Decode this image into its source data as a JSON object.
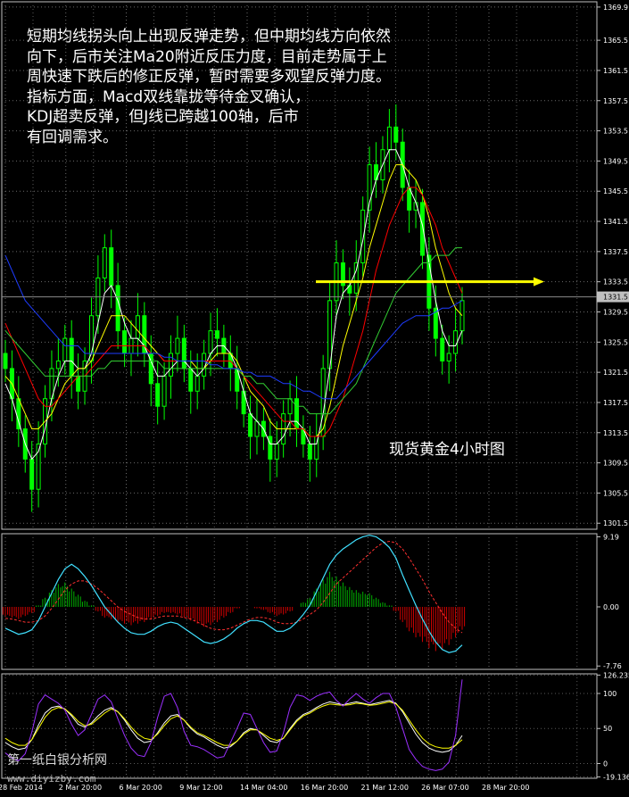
{
  "annotation_lines": [
    "短期均线拐头向上出现反弹走势，但中期均线方向依然",
    "向下，后市关注Ma20附近反压力度，目前走势属于上",
    "周快速下跌后的修正反弹，暂时需要多观望反弹力度。",
    "指标方面，Macd双线靠拢等待金叉确认，",
    "KDJ超卖反弹，但J线已跨越100轴，后市",
    "有回调需求。"
  ],
  "chart_label": "现货黄金4小时图",
  "watermark": "第一纸白银分析网",
  "watermark_url": "www.diyizby.com",
  "colors": {
    "background": "#000000",
    "candle": "#00ff00",
    "ma_fast": "#ffffff",
    "ma_yellow": "#ffff00",
    "ma_red": "#ff0000",
    "ma_green": "#32cd32",
    "ma_blue": "#1e3cff",
    "macd_up": "#00b000",
    "macd_down": "#d00000",
    "macd_signal": "#ff3030",
    "macd_line": "#40e0ff",
    "kdj_k": "#ffffff",
    "kdj_d": "#ffff00",
    "kdj_j": "#9b30ff",
    "arrow": "#ffff00",
    "price_marker": "#c0c0c0"
  },
  "chart_data": [
    {
      "type": "candlestick",
      "panel": "price",
      "y_ticks": [
        1369.9,
        1365.5,
        1361.5,
        1357.5,
        1353.5,
        1349.5,
        1345.5,
        1341.5,
        1337.5,
        1333.5,
        1329.5,
        1325.5,
        1321.5,
        1317.5,
        1313.5,
        1309.5,
        1305.5,
        1301.5
      ],
      "ylim": [
        1300.7,
        1370.6
      ],
      "current_price": 1331.5,
      "arrow_level": 1333.5,
      "x_ticks": [
        "28 Feb 2014",
        "2 Mar 20:00",
        "6 Mar 20:00",
        "9 Mar 12:00",
        "14 Mar 04:00",
        "16 Mar 20:00",
        "21 Mar 12:00",
        "26 Mar 07:00",
        "28 Mar 20:00"
      ],
      "series": [
        {
          "name": "",
          "type": "candles",
          "close": [
            1322.0,
            1318.0,
            1314.0,
            1310.0,
            1306.0,
            1312.0,
            1318.0,
            1322.0,
            1323.0,
            1326.0,
            1321.0,
            1319.0,
            1323.0,
            1329.0,
            1334.0,
            1338.0,
            1333.0,
            1327.0,
            1324.0,
            1326.0,
            1329.0,
            1324.0,
            1320.0,
            1317.0,
            1321.0,
            1324.0,
            1326.0,
            1322.0,
            1319.0,
            1321.0,
            1324.0,
            1327.0,
            1326.0,
            1324.0,
            1322.0,
            1319.0,
            1316.0,
            1313.0,
            1315.0,
            1313.0,
            1310.0,
            1312.0,
            1316.0,
            1318.0,
            1314.0,
            1312.0,
            1310.0,
            1313.0,
            1322.0,
            1331.0,
            1336.0,
            1333.0,
            1332.0,
            1336.0,
            1343.0,
            1349.0,
            1347.0,
            1351.0,
            1354.0,
            1352.0,
            1346.0,
            1343.0,
            1344.0,
            1337.0,
            1330.0,
            1326.0,
            1323.0,
            1324.0,
            1327.0,
            1331.0
          ]
        },
        {
          "name": "",
          "type": "ma",
          "values": [
            1320.0,
            1318.0,
            1315.0,
            1312.0,
            1310.0,
            1311.0,
            1314.0,
            1318.0,
            1321.0,
            1323.0,
            1323.0,
            1322.0,
            1322.0,
            1324.0,
            1328.0,
            1332.0,
            1333.0,
            1331.0,
            1328.0,
            1326.0,
            1326.0,
            1325.0,
            1323.0,
            1321.0,
            1321.0,
            1322.0,
            1323.0,
            1323.0,
            1322.0,
            1321.0,
            1322.0,
            1324.0,
            1325.0,
            1325.0,
            1324.0,
            1322.0,
            1319.0,
            1316.0,
            1315.0,
            1314.0,
            1312.0,
            1312.0,
            1313.0,
            1315.0,
            1315.0,
            1314.0,
            1312.0,
            1312.0,
            1316.0,
            1322.0,
            1329.0,
            1332.0,
            1333.0,
            1335.0,
            1339.0,
            1344.0,
            1347.0,
            1349.0,
            1351.0,
            1351.0,
            1349.0,
            1346.0,
            1344.0,
            1341.0,
            1336.0,
            1331.0,
            1327.0,
            1325.0,
            1325.0,
            1327.0
          ]
        },
        {
          "name": "",
          "type": "ma",
          "values": [
            1321.0,
            1320.0,
            1318.0,
            1316.0,
            1314.0,
            1314.0,
            1315.0,
            1316.0,
            1318.0,
            1320.0,
            1321.0,
            1322.0,
            1322.0,
            1323.0,
            1325.0,
            1327.0,
            1329.0,
            1329.0,
            1329.0,
            1328.0,
            1327.0,
            1326.0,
            1325.0,
            1324.0,
            1323.0,
            1323.0,
            1323.0,
            1323.0,
            1323.0,
            1322.0,
            1322.0,
            1323.0,
            1324.0,
            1324.0,
            1324.0,
            1323.0,
            1321.0,
            1319.0,
            1318.0,
            1317.0,
            1315.0,
            1314.0,
            1314.0,
            1314.0,
            1314.0,
            1314.0,
            1313.0,
            1313.0,
            1314.0,
            1317.0,
            1321.0,
            1325.0,
            1328.0,
            1331.0,
            1334.0,
            1338.0,
            1341.0,
            1344.0,
            1347.0,
            1349.0,
            1349.0,
            1348.0,
            1347.0,
            1345.0,
            1342.0,
            1338.0,
            1335.0,
            1332.0,
            1330.0,
            1329.0
          ]
        },
        {
          "name": "",
          "type": "ma",
          "values": [
            1328.0,
            1326.0,
            1324.0,
            1322.0,
            1320.0,
            1318.0,
            1317.0,
            1317.0,
            1318.0,
            1319.0,
            1320.0,
            1321.0,
            1321.0,
            1322.0,
            1323.0,
            1324.0,
            1325.0,
            1325.0,
            1325.0,
            1325.0,
            1325.0,
            1325.0,
            1324.0,
            1324.0,
            1323.0,
            1323.0,
            1323.0,
            1323.0,
            1323.0,
            1323.0,
            1323.0,
            1323.0,
            1323.0,
            1323.0,
            1323.0,
            1322.0,
            1321.0,
            1320.0,
            1319.0,
            1318.0,
            1317.0,
            1316.0,
            1315.0,
            1315.0,
            1314.0,
            1314.0,
            1313.0,
            1313.0,
            1313.0,
            1314.0,
            1316.0,
            1318.0,
            1321.0,
            1324.0,
            1327.0,
            1331.0,
            1335.0,
            1338.0,
            1341.0,
            1343.0,
            1345.0,
            1346.0,
            1346.0,
            1345.0,
            1343.0,
            1341.0,
            1338.0,
            1336.0,
            1334.0,
            1332.0
          ]
        },
        {
          "name": "",
          "type": "ma",
          "values": [
            1327.0,
            1326.0,
            1325.0,
            1324.0,
            1323.0,
            1322.0,
            1321.0,
            1321.0,
            1321.0,
            1321.0,
            1321.0,
            1321.0,
            1321.0,
            1321.0,
            1322.0,
            1322.0,
            1323.0,
            1323.0,
            1323.0,
            1323.0,
            1323.0,
            1323.0,
            1323.0,
            1323.0,
            1322.0,
            1322.0,
            1322.0,
            1322.0,
            1322.0,
            1322.0,
            1322.0,
            1322.0,
            1322.0,
            1322.0,
            1322.0,
            1322.0,
            1321.0,
            1321.0,
            1320.0,
            1320.0,
            1319.0,
            1318.0,
            1318.0,
            1318.0,
            1317.0,
            1317.0,
            1316.0,
            1316.0,
            1316.0,
            1316.0,
            1317.0,
            1318.0,
            1319.0,
            1320.0,
            1322.0,
            1324.0,
            1326.0,
            1328.0,
            1330.0,
            1332.0,
            1333.0,
            1334.0,
            1335.0,
            1336.0,
            1336.0,
            1337.0,
            1337.0,
            1337.0,
            1338.0,
            1338.0
          ]
        },
        {
          "name": "",
          "type": "ma",
          "values": [
            1337.0,
            1335.0,
            1333.0,
            1331.0,
            1330.0,
            1329.0,
            1328.0,
            1327.0,
            1326.0,
            1325.0,
            1325.0,
            1325.0,
            1324.0,
            1324.0,
            1324.0,
            1324.0,
            1324.0,
            1324.0,
            1324.0,
            1324.0,
            1324.0,
            1324.0,
            1324.0,
            1324.0,
            1323.5,
            1323.5,
            1323.0,
            1323.0,
            1323.0,
            1323.0,
            1323.0,
            1322.5,
            1322.5,
            1322.0,
            1322.0,
            1322.0,
            1321.5,
            1321.5,
            1321.0,
            1321.0,
            1321.0,
            1320.5,
            1320.0,
            1320.0,
            1319.5,
            1319.0,
            1319.0,
            1318.5,
            1318.0,
            1318.0,
            1318.0,
            1319.0,
            1320.0,
            1321.0,
            1322.0,
            1323.0,
            1324.0,
            1325.0,
            1326.0,
            1327.0,
            1328.0,
            1328.5,
            1329.0,
            1329.0,
            1329.0,
            1329.5,
            1330.0,
            1330.0,
            1330.5,
            1331.0
          ]
        }
      ]
    },
    {
      "type": "bar",
      "panel": "macd",
      "y_ticks": [
        9.19,
        0.0,
        -7.76
      ],
      "ylim": [
        -8.2,
        9.6
      ],
      "series": [
        {
          "name": "",
          "type": "histogram",
          "values": [
            -1.2,
            -1.4,
            -1.6,
            -1.2,
            -0.8,
            0.2,
            1.2,
            2.2,
            3.0,
            3.2,
            2.4,
            1.6,
            0.8,
            0.2,
            -0.6,
            -1.4,
            -1.6,
            -2.0,
            -2.2,
            -2.4,
            -2.2,
            -2.0,
            -1.6,
            -1.2,
            -0.8,
            -0.8,
            -1.0,
            -1.4,
            -1.8,
            -2.2,
            -2.6,
            -2.4,
            -2.0,
            -1.4,
            -0.8,
            -0.2,
            0.0,
            0.0,
            -0.2,
            -0.4,
            -0.8,
            -1.2,
            -1.0,
            -0.6,
            0.0,
            0.6,
            1.2,
            2.4,
            3.6,
            4.6,
            4.0,
            3.2,
            2.6,
            2.2,
            2.0,
            1.8,
            1.2,
            0.6,
            0.2,
            -0.6,
            -2.0,
            -3.2,
            -4.0,
            -4.6,
            -5.4,
            -5.8,
            -5.6,
            -5.0,
            -4.0,
            -3.0
          ]
        },
        {
          "name": "",
          "type": "line",
          "values": [
            -1.5,
            -1.6,
            -1.8,
            -2.0,
            -2.0,
            -1.8,
            -1.2,
            -0.2,
            1.0,
            2.2,
            3.0,
            3.4,
            3.4,
            3.0,
            2.4,
            1.6,
            0.8,
            0.0,
            -0.6,
            -1.0,
            -1.4,
            -1.6,
            -1.6,
            -1.4,
            -1.2,
            -1.2,
            -1.2,
            -1.4,
            -1.6,
            -2.0,
            -2.4,
            -2.8,
            -3.0,
            -3.0,
            -2.8,
            -2.4,
            -2.0,
            -1.6,
            -1.4,
            -1.4,
            -1.6,
            -2.0,
            -2.2,
            -2.2,
            -2.0,
            -1.6,
            -1.0,
            -0.4,
            0.6,
            1.8,
            3.0,
            3.8,
            4.6,
            5.4,
            6.2,
            7.0,
            7.8,
            8.4,
            8.6,
            8.4,
            7.6,
            6.4,
            5.0,
            3.6,
            2.0,
            0.6,
            -0.8,
            -2.0,
            -2.8,
            -3.4
          ]
        },
        {
          "name": "",
          "type": "line",
          "values": [
            -2.8,
            -3.2,
            -3.6,
            -3.4,
            -3.0,
            -1.8,
            0.0,
            1.8,
            3.6,
            5.0,
            5.6,
            5.0,
            4.0,
            2.8,
            1.4,
            0.0,
            -1.0,
            -2.0,
            -2.8,
            -3.4,
            -3.6,
            -3.6,
            -3.2,
            -2.6,
            -2.2,
            -2.0,
            -2.2,
            -2.8,
            -3.4,
            -4.0,
            -4.6,
            -4.8,
            -4.6,
            -4.2,
            -3.6,
            -2.8,
            -2.2,
            -1.8,
            -1.8,
            -2.0,
            -2.6,
            -3.2,
            -3.2,
            -2.8,
            -2.0,
            -1.0,
            0.2,
            2.0,
            3.8,
            5.6,
            6.8,
            7.6,
            8.2,
            8.8,
            9.2,
            9.4,
            9.2,
            8.6,
            7.8,
            6.4,
            4.2,
            2.2,
            0.2,
            -1.6,
            -3.2,
            -4.6,
            -5.6,
            -6.0,
            -5.8,
            -5.0
          ]
        }
      ]
    },
    {
      "type": "line",
      "panel": "kdj",
      "y_ticks": [
        126.235,
        100,
        50,
        0,
        -19.1369
      ],
      "ylim": [
        -21,
        128
      ],
      "series": [
        {
          "name": "",
          "values": [
            30,
            24,
            20,
            22,
            34,
            55,
            72,
            80,
            82,
            78,
            68,
            56,
            52,
            58,
            68,
            76,
            80,
            74,
            62,
            48,
            36,
            30,
            32,
            44,
            58,
            68,
            70,
            62,
            50,
            42,
            38,
            32,
            26,
            22,
            24,
            32,
            44,
            50,
            48,
            40,
            32,
            30,
            36,
            50,
            62,
            70,
            74,
            80,
            85,
            88,
            86,
            84,
            86,
            88,
            86,
            84,
            86,
            88,
            90,
            86,
            74,
            58,
            42,
            30,
            22,
            18,
            16,
            18,
            26,
            40
          ]
        },
        {
          "name": "",
          "values": [
            36,
            30,
            26,
            26,
            34,
            50,
            66,
            76,
            80,
            78,
            70,
            60,
            54,
            56,
            64,
            72,
            78,
            74,
            64,
            52,
            42,
            36,
            34,
            42,
            54,
            64,
            68,
            62,
            52,
            44,
            40,
            35,
            30,
            26,
            26,
            32,
            42,
            48,
            48,
            42,
            36,
            33,
            36,
            48,
            60,
            68,
            72,
            78,
            82,
            85,
            84,
            83,
            84,
            86,
            85,
            83,
            84,
            86,
            88,
            85,
            76,
            62,
            48,
            36,
            28,
            24,
            22,
            22,
            26,
            34
          ]
        },
        {
          "name": "",
          "values": [
            15,
            8,
            4,
            14,
            45,
            85,
            98,
            92,
            86,
            76,
            56,
            40,
            48,
            70,
            92,
            98,
            88,
            64,
            40,
            22,
            12,
            10,
            30,
            66,
            96,
            100,
            80,
            46,
            26,
            24,
            20,
            14,
            8,
            10,
            30,
            50,
            72,
            70,
            50,
            30,
            16,
            18,
            44,
            80,
            98,
            96,
            90,
            96,
            100,
            102,
            90,
            82,
            92,
            100,
            92,
            86,
            94,
            100,
            100,
            80,
            50,
            20,
            6,
            -4,
            -8,
            -10,
            -8,
            2,
            40,
            120
          ]
        }
      ]
    }
  ]
}
